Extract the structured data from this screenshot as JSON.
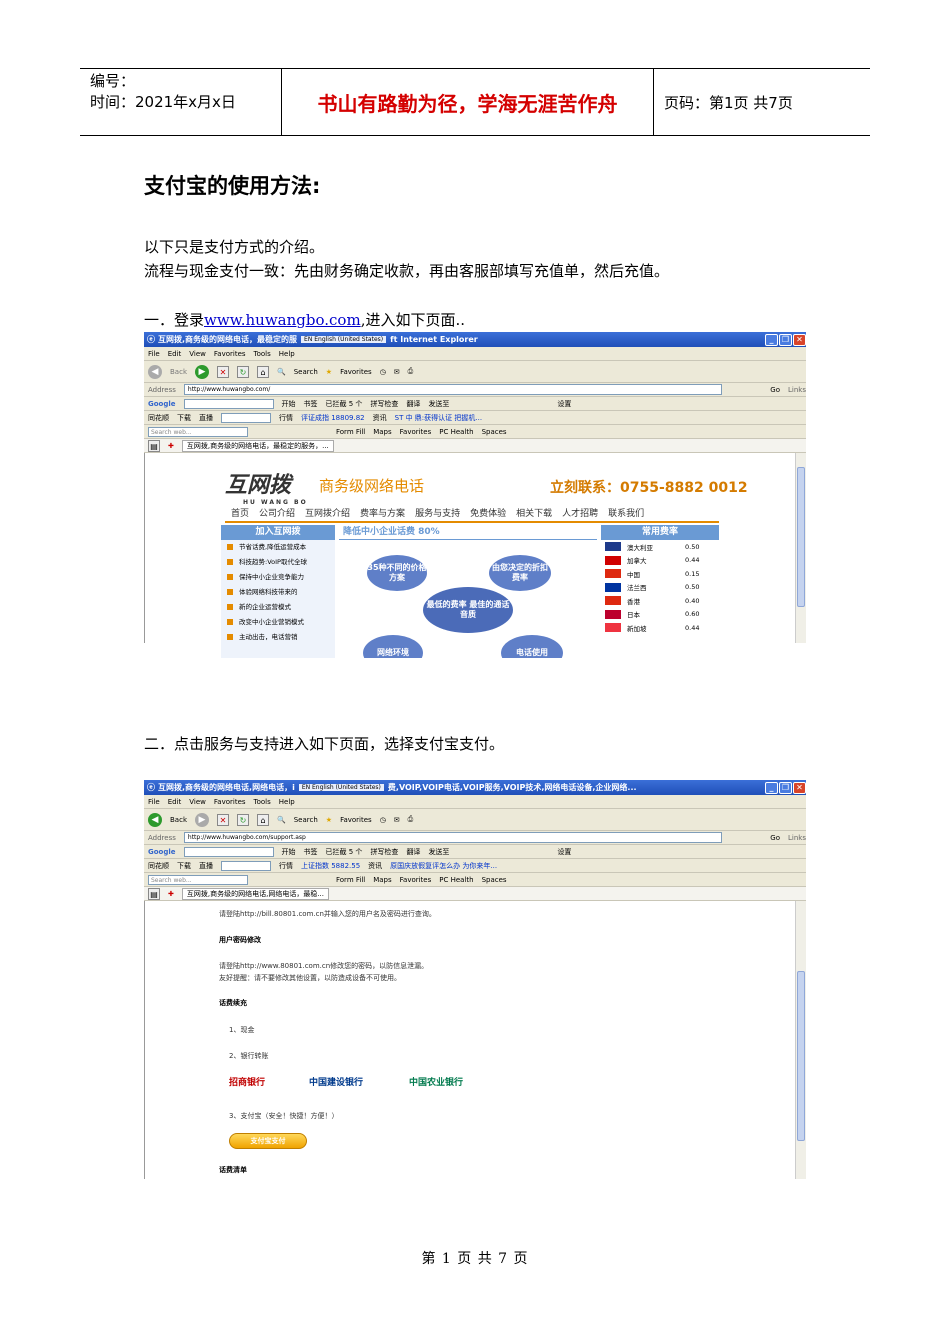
{
  "header": {
    "number_label": "编号：",
    "time_label": "时间：2021年x月x日",
    "motto": "书山有路勤为径，学海无涯苦作舟",
    "page_label": "页码：第1页  共7页"
  },
  "doc": {
    "title": "支付宝的使用方法:",
    "intro1": "以下只是支付方式的介绍。",
    "intro2": "流程与现金支付一致：先由财务确定收款，再由客服部填写充值单，然后充值。",
    "step1_prefix": "一．登录",
    "step1_link": "www.huwangbo.com",
    "step1_suffix": ",进入如下页面..",
    "step2": "二．点击服务与支持进入如下页面，选择支付宝支付。",
    "footer": "第 1 页 共 7 页"
  },
  "browser1": {
    "title": "互网拨,商务级的网络电话，最稳定的服",
    "lang": "EN English (United States)",
    "title_tail": "ft Internet Explorer",
    "menu": [
      "File",
      "Edit",
      "View",
      "Favorites",
      "Tools",
      "Help"
    ],
    "back": "Back",
    "search": "Search",
    "favorites": "Favorites",
    "address_label": "Address",
    "url": "http://www.huwangbo.com/",
    "go": "Go",
    "links": "Links",
    "google": "Google",
    "g_start": "开始",
    "g_bookmark": "书签",
    "g_blocked": "已拦截 5 个",
    "g_spell": "拼写检查",
    "g_translate": "翻译",
    "g_send": "发送至",
    "g_settings": "设置",
    "ths": "同花顺",
    "download": "下载",
    "live": "直播",
    "quotes": "行情",
    "ticker": "评证成指  18809.82",
    "news": "资讯",
    "news_text": "ST 中 鼎:获得认证 把握机...",
    "search_web": "Search web...",
    "formfill": "Form Fill",
    "maps": "Maps",
    "favs": "Favorites",
    "pchealth": "PC Health",
    "spaces": "Spaces",
    "tab": "互网拨,商务级的网络电话，最稳定的服务，...",
    "site": {
      "logo": "互网拨",
      "logo_en": "HU WANG BO",
      "slogan": "商务级网络电话",
      "hotline": "立刻联系：0755-8882 0012",
      "nav": [
        "首页",
        "公司介绍",
        "互网拨介绍",
        "费率与方案",
        "服务与支持",
        "免费体验",
        "相关下载",
        "人才招聘",
        "联系我们"
      ],
      "left_title": "加入互网拨",
      "left_items": [
        "节省话费,降低运营成本",
        "科技趋势:VoIP取代全球",
        "保持中小企业竞争能力",
        "体验网络科技带来的",
        "新的企业运营模式",
        "改变中小企业营销模式",
        "主动出击，电话营销"
      ],
      "center_title": "降低中小企业话费 80%",
      "bubble1": "35种不同的价格方案",
      "bubble2": "由您决定的折扣费率",
      "bubble_center": "最低的费率 最佳的通话音质",
      "bubble3": "网络环境",
      "bubble4": "电话使用",
      "right_title": "常用费率",
      "rates": [
        {
          "country": "澳大利亚",
          "rate": "0.50",
          "color": "#1e3a8a"
        },
        {
          "country": "加拿大",
          "rate": "0.44",
          "color": "#d00000"
        },
        {
          "country": "中国",
          "rate": "0.15",
          "color": "#de2910"
        },
        {
          "country": "法兰西",
          "rate": "0.50",
          "color": "#0033a0"
        },
        {
          "country": "香港",
          "rate": "0.40",
          "color": "#de2910"
        },
        {
          "country": "日本",
          "rate": "0.60",
          "color": "#bc002d"
        },
        {
          "country": "新加坡",
          "rate": "0.44",
          "color": "#ef3340"
        }
      ]
    }
  },
  "browser2": {
    "title": "互网拨,商务级的网络电话,网络电话，i",
    "lang": "EN English (United States)",
    "title_tail": "费,VOIP,VOIP电话,VOIP服务,VOIP技术,网络电话设备,企业网络...",
    "url": "http://www.huwangbo.com/support.asp",
    "ticker": "上证指数  5882.55",
    "news_text": "原国庆放假复评怎么办 为你来年...",
    "tab": "互网拨,商务级的网络电话,网络电话，最稳...",
    "site": {
      "line1": "请登陆http://bill.80801.com.cn并输入您的用户名及密码进行查询。",
      "pw_title": "用户密码修改",
      "line2": "请登陆http://www.80801.com.cn修改您的密码，以防信息泄漏。",
      "line3": "友好提醒：请不要修改其他设置，以防造成设备不可使用。",
      "fee_title": "话费续充",
      "opt1": "1、现金",
      "opt2": "2、银行转账",
      "bank1": "招商银行",
      "bank2": "中国建设银行",
      "bank3": "中国农业银行",
      "opt3": "3、支付宝（安全！快捷！方便！）",
      "alipay_btn": "支付宝支付",
      "bill_title": "话费清单"
    }
  }
}
